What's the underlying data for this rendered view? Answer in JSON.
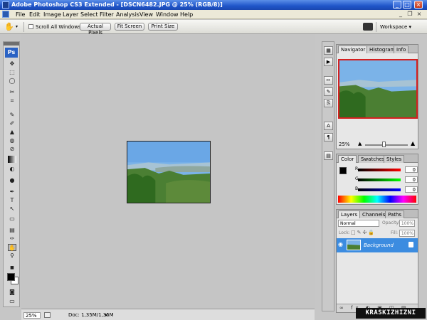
{
  "window": {
    "title": "Adobe Photoshop CS3 Extended - [DSCN6482.JPG @ 25% (RGB/8)]",
    "minimize": "_",
    "maximize": "□",
    "close": "×"
  },
  "menu": {
    "items": [
      "File",
      "Edit",
      "Image",
      "Layer",
      "Select",
      "Filter",
      "Analysis",
      "View",
      "Window",
      "Help"
    ],
    "doc_minimize": "_",
    "doc_restore": "❐",
    "doc_close": "×"
  },
  "options": {
    "tool_icon": "hand-icon",
    "scroll_all_label": "Scroll All Windows",
    "actual_pixels": "Actual Pixels",
    "fit_screen": "Fit Screen",
    "print_size": "Print Size",
    "workspace": "Workspace ▾"
  },
  "tools": {
    "logo": "Ps",
    "glyphs": [
      "✥",
      "⬚",
      "◯",
      "✂",
      "⌗",
      "✎",
      "✐",
      "▲",
      "◍",
      "⊘",
      "◐",
      "✒",
      "T",
      "↖",
      "▭",
      "☞",
      "🔍",
      "✋"
    ]
  },
  "status": {
    "zoom": "25%",
    "doc": "Doc: 1,35M/1,35M"
  },
  "navigator": {
    "tabs": [
      "Navigator",
      "Histogram",
      "Info"
    ],
    "zoom": "25%"
  },
  "color": {
    "tabs": [
      "Color",
      "Swatches",
      "Styles"
    ],
    "channels": [
      {
        "label": "R",
        "value": "0",
        "color": "#e02020"
      },
      {
        "label": "G",
        "value": "0",
        "color": "#20b020"
      },
      {
        "label": "B",
        "value": "0",
        "color": "#2030d0"
      }
    ]
  },
  "layers": {
    "tabs": [
      "Layers",
      "Channels",
      "Paths"
    ],
    "blend_mode": "Normal",
    "opacity_label": "Opacity:",
    "opacity_value": "100%",
    "lock_label": "Lock:",
    "fill_label": "Fill:",
    "fill_value": "100%",
    "layer_name": "Background"
  },
  "brand": "KRASKIZHIZNI",
  "colors": {
    "titlebar": "#1f55c9",
    "selection": "#3c8ce0",
    "sky": "#7bb3e8",
    "forest": "#3f7a2a"
  }
}
